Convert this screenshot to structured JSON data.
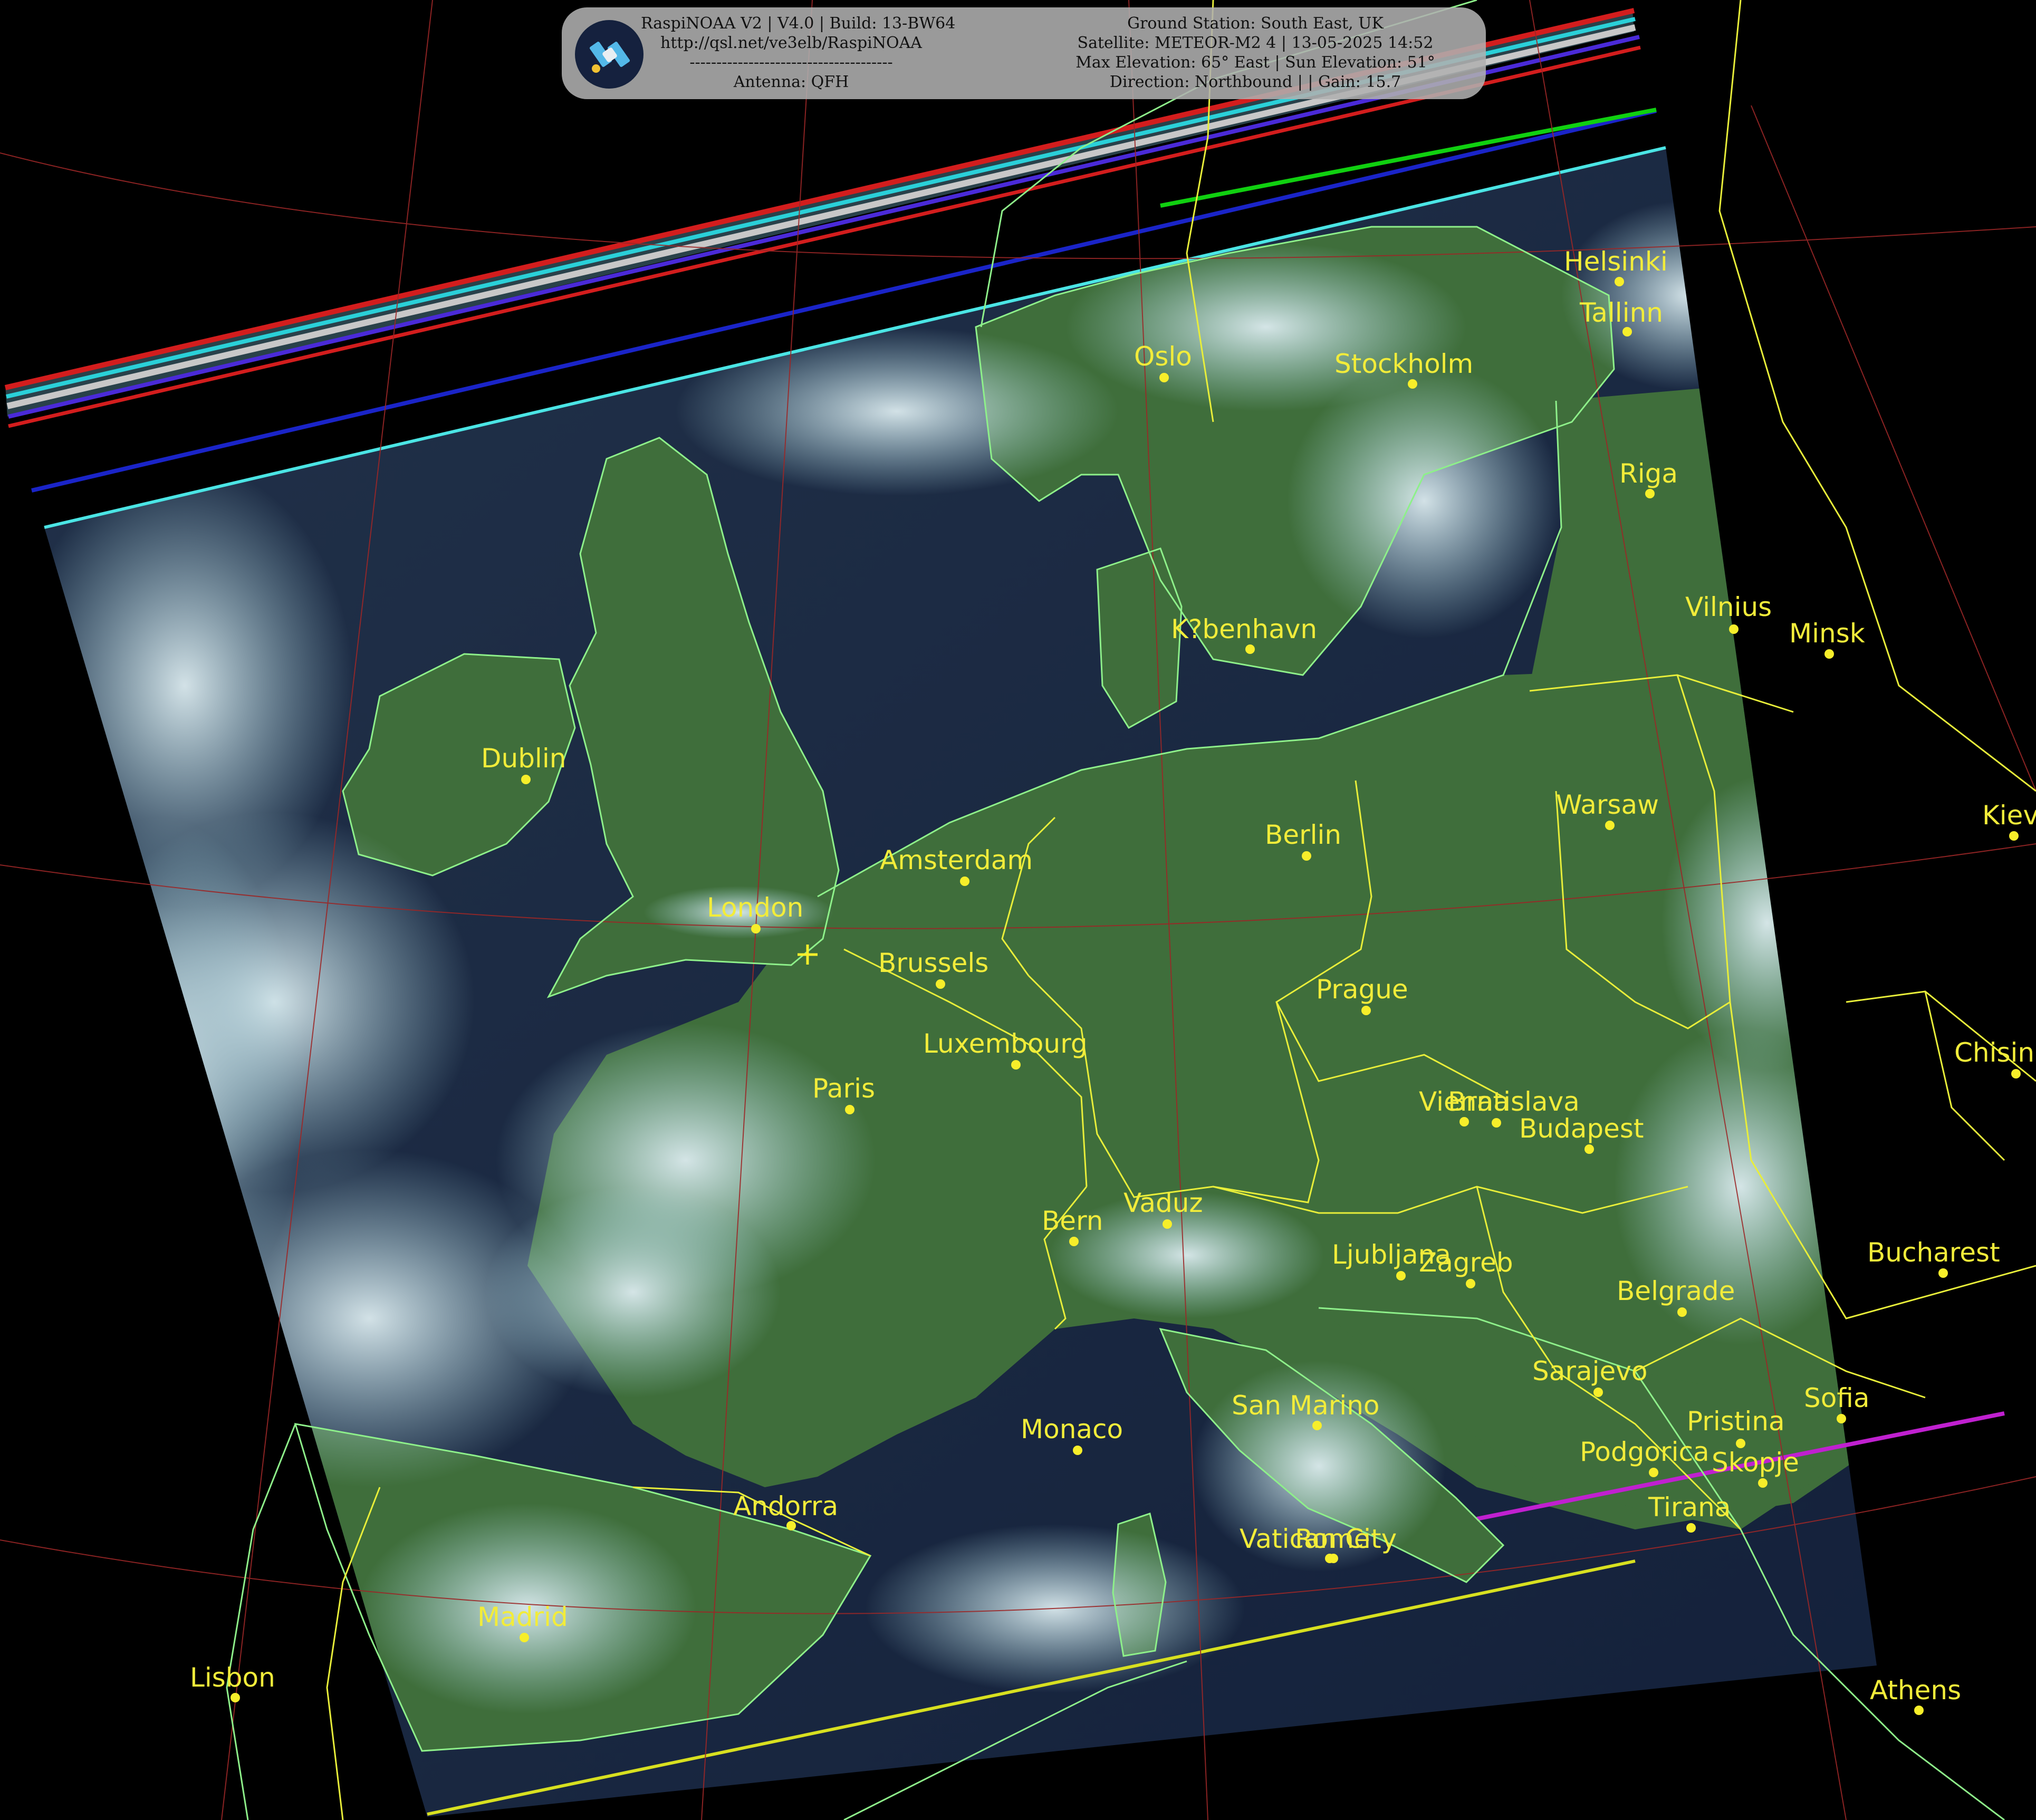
{
  "header": {
    "left_lines": [
      "RaspiNOAA V2 | V4.0 | Build: 13-BW64",
      "http://qsl.net/ve3elb/RaspiNOAA",
      "--------------------------------------",
      "Antenna: QFH"
    ],
    "right_lines": [
      "Ground Station: South East, UK",
      "Satellite: METEOR-M2 4 | 13-05-2025 14:52",
      "Max Elevation: 65° East | Sun Elevation: 51°",
      "Direction: Northbound | | Gain: 15.7"
    ],
    "logo_icon": "satellite-icon"
  },
  "cities": [
    {
      "name": "Helsinki"
    },
    {
      "name": "Tallinn"
    },
    {
      "name": "Oslo"
    },
    {
      "name": "Stockholm"
    },
    {
      "name": "Riga"
    },
    {
      "name": "Vilnius"
    },
    {
      "name": "Minsk"
    },
    {
      "name": "K?benhavn"
    },
    {
      "name": "Dublin"
    },
    {
      "name": "Warsaw"
    },
    {
      "name": "Kiev"
    },
    {
      "name": "Berlin"
    },
    {
      "name": "Amsterdam"
    },
    {
      "name": "London"
    },
    {
      "name": "Brussels"
    },
    {
      "name": "Prague"
    },
    {
      "name": "Luxembourg"
    },
    {
      "name": "Chisinau"
    },
    {
      "name": "Paris"
    },
    {
      "name": "Vienna"
    },
    {
      "name": "Bratislava"
    },
    {
      "name": "Budapest"
    },
    {
      "name": "Vaduz"
    },
    {
      "name": "Bern"
    },
    {
      "name": "Bucharest"
    },
    {
      "name": "Ljubljana"
    },
    {
      "name": "Zagreb"
    },
    {
      "name": "Belgrade"
    },
    {
      "name": "Sarajevo"
    },
    {
      "name": "San Marino"
    },
    {
      "name": "Sofia"
    },
    {
      "name": "Pristina"
    },
    {
      "name": "Monaco"
    },
    {
      "name": "Podgorica"
    },
    {
      "name": "Skopje"
    },
    {
      "name": "Andorra"
    },
    {
      "name": "Tirana"
    },
    {
      "name": "Vatican City"
    },
    {
      "name": "Rome"
    },
    {
      "name": "Madrid"
    },
    {
      "name": "Lisbon"
    },
    {
      "name": "Athens"
    }
  ],
  "colors": {
    "background": "#000000",
    "land": "#3e6e3c",
    "sea": "#17253a",
    "cloud": "#c9dfe2",
    "coastline": "#8ef08a",
    "border": "#e8ee3a",
    "graticule": "#a02828",
    "label": "#f2ec3a"
  },
  "ground_station_marker": "plus-marker"
}
